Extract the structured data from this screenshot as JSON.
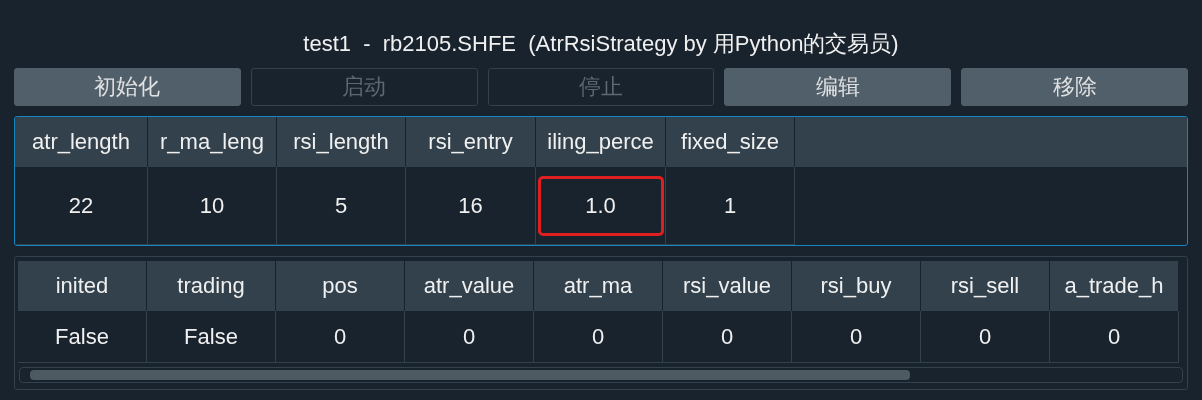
{
  "window": {
    "title": "test1  -  rb2105.SHFE  (AtrRsiStrategy by 用Python的交易员)"
  },
  "buttons": [
    {
      "label": "初始化",
      "disabled": false
    },
    {
      "label": "启动",
      "disabled": true
    },
    {
      "label": "停止",
      "disabled": true
    },
    {
      "label": "编辑",
      "disabled": false
    },
    {
      "label": "移除",
      "disabled": false
    }
  ],
  "parameters": {
    "columns": [
      "atr_length",
      "r_ma_leng",
      "rsi_length",
      "rsi_entry",
      "iling_perce",
      "fixed_size"
    ],
    "rows": [
      [
        {
          "text": "22",
          "highlighted": false
        },
        {
          "text": "10",
          "highlighted": false
        },
        {
          "text": "5",
          "highlighted": false
        },
        {
          "text": "16",
          "highlighted": false
        },
        {
          "text": "1.0",
          "highlighted": true
        },
        {
          "text": "1",
          "highlighted": false
        }
      ]
    ]
  },
  "variables": {
    "columns": [
      "inited",
      "trading",
      "pos",
      "atr_value",
      "atr_ma",
      "rsi_value",
      "rsi_buy",
      "rsi_sell",
      "a_trade_h"
    ],
    "rows": [
      [
        "False",
        "False",
        "0",
        "0",
        "0",
        "0",
        "0",
        "0",
        "0"
      ]
    ]
  }
}
